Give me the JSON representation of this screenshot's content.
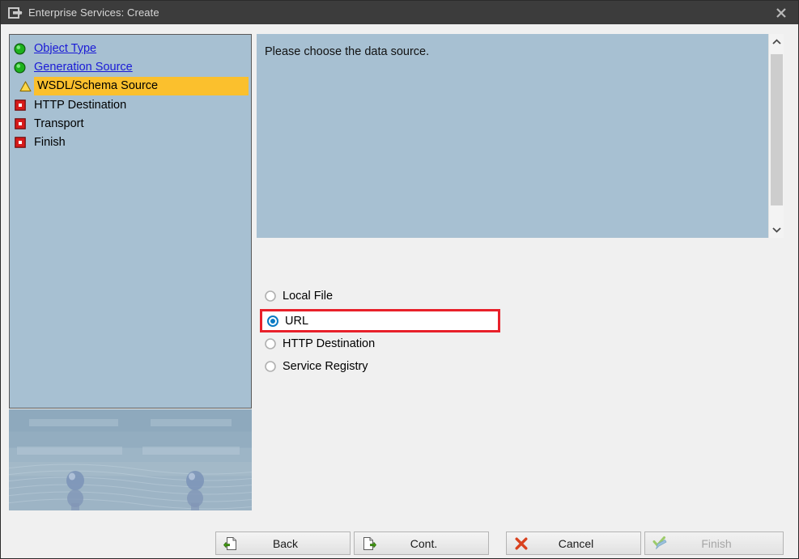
{
  "window": {
    "title": "Enterprise Services: Create",
    "icon": "wizard-hand-icon",
    "close_label": "✕",
    "titlebar_color": "#3c3c3c"
  },
  "roadmap": {
    "items": [
      {
        "label": "Object Type",
        "status": "done",
        "icon": "green-circle-icon"
      },
      {
        "label": "Generation Source",
        "status": "done",
        "icon": "green-circle-icon"
      },
      {
        "label": "WSDL/Schema Source",
        "status": "current",
        "icon": "yellow-triangle-icon"
      },
      {
        "label": "HTTP Destination",
        "status": "pending",
        "icon": "red-square-icon"
      },
      {
        "label": "Transport",
        "status": "pending",
        "icon": "red-square-icon"
      },
      {
        "label": "Finish",
        "status": "pending",
        "icon": "red-square-icon"
      }
    ],
    "colors": {
      "panel_background": "#a7c0d2",
      "current_highlight": "#fbc02d",
      "link_text": "#1a1ad6",
      "done_icon": "#16b516",
      "current_icon": "#f5d020",
      "pending_icon": "#e01b1b"
    }
  },
  "message": {
    "text": "Please choose the data source.",
    "background": "#a7c0d2"
  },
  "scrollbar": {
    "up_arrow": "chevron-up-icon",
    "down_arrow": "chevron-down-icon",
    "thumb_color": "#cdcdcd"
  },
  "data_source": {
    "selected": "URL",
    "highlight_color": "#e8202a",
    "options": [
      {
        "label": "Local File",
        "selected": false,
        "highlighted": false
      },
      {
        "label": "URL",
        "selected": true,
        "highlighted": true
      },
      {
        "label": "HTTP Destination",
        "selected": false,
        "highlighted": false
      },
      {
        "label": "Service Registry",
        "selected": false,
        "highlighted": false
      }
    ]
  },
  "footer": {
    "buttons": [
      {
        "label": "Back",
        "icon": "page-back-icon",
        "enabled": true
      },
      {
        "label": "Cont.",
        "icon": "page-forward-icon",
        "enabled": true
      },
      {
        "label": "Cancel",
        "icon": "red-x-icon",
        "enabled": true
      },
      {
        "label": "Finish",
        "icon": "check-pencil-icon",
        "enabled": false
      }
    ]
  }
}
